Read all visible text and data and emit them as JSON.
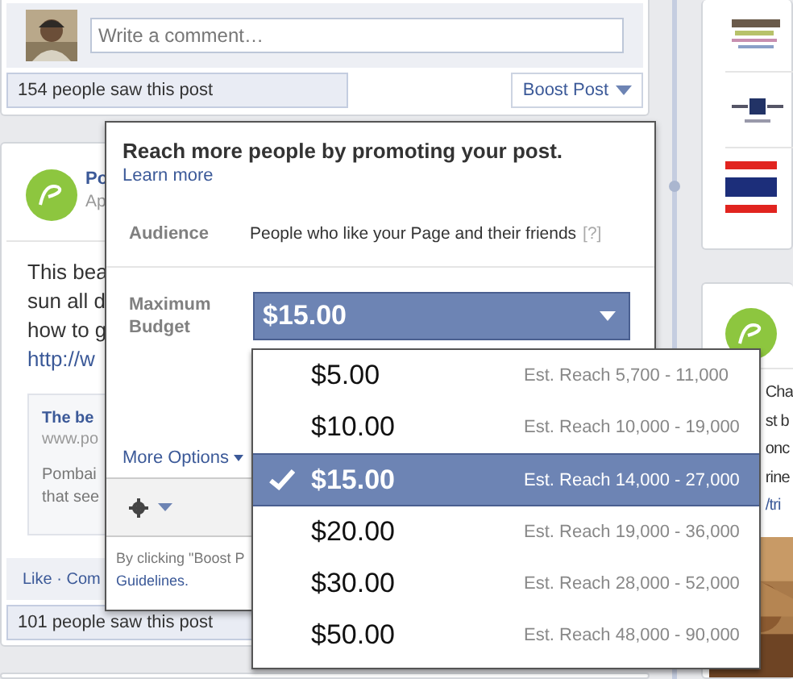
{
  "comment_box": {
    "placeholder": "Write a comment…"
  },
  "top_post": {
    "views": "154 people saw this post",
    "boost_button": "Boost Post"
  },
  "post": {
    "author": "Po",
    "meta": "Ap",
    "text_lines": [
      {
        "text": "This bea",
        "kind": "text"
      },
      {
        "text": "sun all d",
        "kind": "text"
      },
      {
        "text": "how to g",
        "kind": "text"
      },
      {
        "text": "http://w",
        "kind": "link"
      }
    ],
    "link": {
      "title": "The be",
      "url": "www.po",
      "desc_lines": [
        "Pombai",
        "that see"
      ]
    },
    "actions": "Like · Com",
    "views": "101 people saw this post"
  },
  "popup": {
    "title": "Reach more people by promoting your post.",
    "learn_more": "Learn more",
    "audience_label": "Audience",
    "audience_value": "People who like your Page and their friends",
    "help": "[?]",
    "budget_label": "Maximum Budget",
    "budget_value": "$15.00",
    "more_options": "More Options",
    "legal_lines": [
      "By clicking \"Boost P",
      "Guidelines."
    ]
  },
  "budget_options": [
    {
      "price": "$5.00",
      "reach": "Est. Reach 5,700 - 11,000",
      "selected": false
    },
    {
      "price": "$10.00",
      "reach": "Est. Reach 10,000 - 19,000",
      "selected": false
    },
    {
      "price": "$15.00",
      "reach": "Est. Reach 14,000 - 27,000",
      "selected": true
    },
    {
      "price": "$20.00",
      "reach": "Est. Reach 19,000 - 36,000",
      "selected": false
    },
    {
      "price": "$30.00",
      "reach": "Est. Reach 28,000 - 52,000",
      "selected": false
    },
    {
      "price": "$50.00",
      "reach": "Est. Reach 48,000 - 90,000",
      "selected": false
    }
  ],
  "sidebar_post": {
    "text_lines": [
      {
        "text": "Cha",
        "kind": "text"
      },
      {
        "text": "st b",
        "kind": "text"
      },
      {
        "text": "onc",
        "kind": "text"
      },
      {
        "text": "rine",
        "kind": "text"
      },
      {
        "text": "/tri",
        "kind": "link"
      }
    ]
  }
}
